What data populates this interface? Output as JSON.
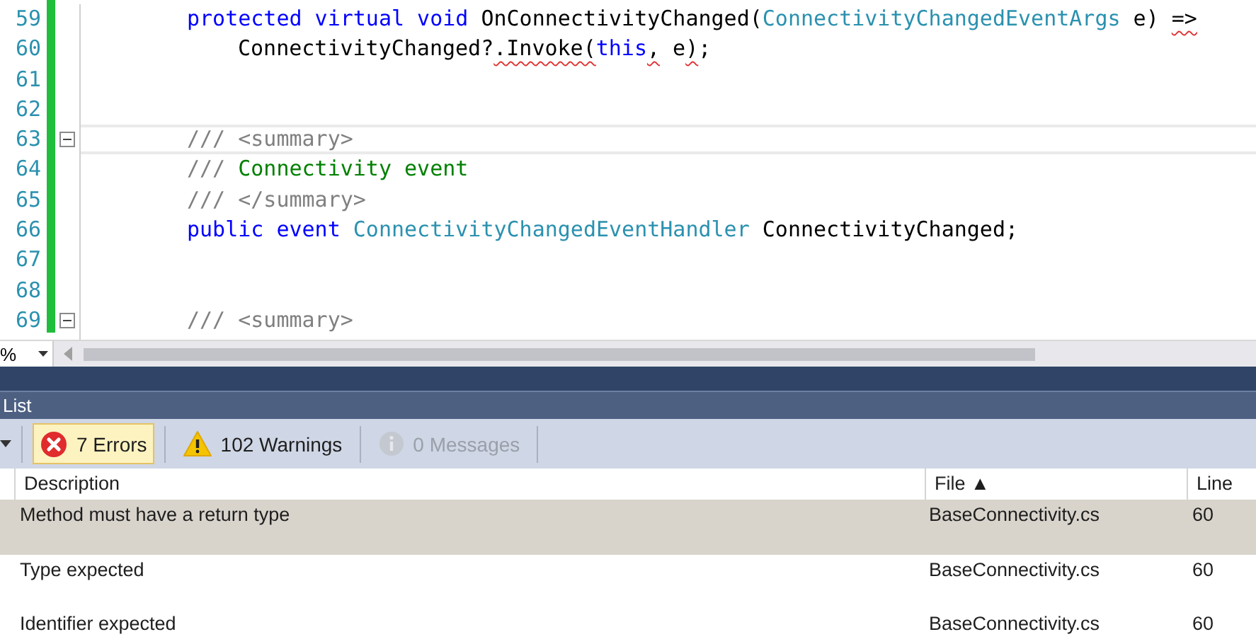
{
  "editor": {
    "lines": [
      {
        "number": "59",
        "kind": "statement",
        "tokens": [
          {
            "kind": "keyword",
            "text": "protected virtual void"
          },
          {
            "kind": "plain",
            "text": " OnConnectivityChanged("
          },
          {
            "kind": "type",
            "text": "ConnectivityChangedEventArgs"
          },
          {
            "kind": "plain",
            "text": " e) "
          },
          {
            "kind": "plain",
            "text": "=>",
            "error": true
          }
        ]
      },
      {
        "number": "60",
        "kind": "continuation",
        "tokens": [
          {
            "kind": "plain",
            "text": "ConnectivityChanged?"
          },
          {
            "kind": "plain",
            "text": ".Invoke(",
            "error": true
          },
          {
            "kind": "keyword",
            "text": "this"
          },
          {
            "kind": "plain",
            "text": ",",
            "error": true
          },
          {
            "kind": "plain",
            "text": " e"
          },
          {
            "kind": "plain",
            "text": ")",
            "error": true
          },
          {
            "kind": "plain",
            "text": ";"
          }
        ]
      },
      {
        "number": "61"
      },
      {
        "number": "62"
      },
      {
        "number": "63",
        "kind": "statement",
        "collapsible": true,
        "current": true,
        "tokens": [
          {
            "kind": "doc",
            "text": "/// <summary>"
          }
        ]
      },
      {
        "number": "64",
        "kind": "statement",
        "tokens": [
          {
            "kind": "doc",
            "text": "/// "
          },
          {
            "kind": "comment",
            "text": "Connectivity event"
          }
        ]
      },
      {
        "number": "65",
        "kind": "statement",
        "tokens": [
          {
            "kind": "doc",
            "text": "/// </summary>"
          }
        ]
      },
      {
        "number": "66",
        "kind": "statement",
        "tokens": [
          {
            "kind": "keyword",
            "text": "public event "
          },
          {
            "kind": "type",
            "text": "ConnectivityChangedEventHandler"
          },
          {
            "kind": "plain",
            "text": " ConnectivityChanged;"
          }
        ]
      },
      {
        "number": "67"
      },
      {
        "number": "68"
      },
      {
        "number": "69",
        "kind": "statement",
        "collapsible": true,
        "tokens": [
          {
            "kind": "doc",
            "text": "/// <summary>"
          }
        ]
      }
    ],
    "zoom": "%"
  },
  "panel": {
    "title": "List",
    "filters": [
      {
        "kind": "errors",
        "label": "7 Errors",
        "selected": true,
        "disabled": false
      },
      {
        "kind": "warnings",
        "label": "102 Warnings",
        "selected": false,
        "disabled": false
      },
      {
        "kind": "messages",
        "label": "0 Messages",
        "selected": false,
        "disabled": true
      }
    ],
    "columns": [
      "Description",
      "File ▲",
      "Line"
    ],
    "rows": [
      {
        "description": "Method must have a return type",
        "file": "BaseConnectivity.cs",
        "line": "60",
        "selected": true
      },
      {
        "description": "Type expected",
        "file": "BaseConnectivity.cs",
        "line": "60",
        "selected": false
      },
      {
        "description": "Identifier expected",
        "file": "BaseConnectivity.cs",
        "line": "60",
        "selected": false
      }
    ]
  }
}
